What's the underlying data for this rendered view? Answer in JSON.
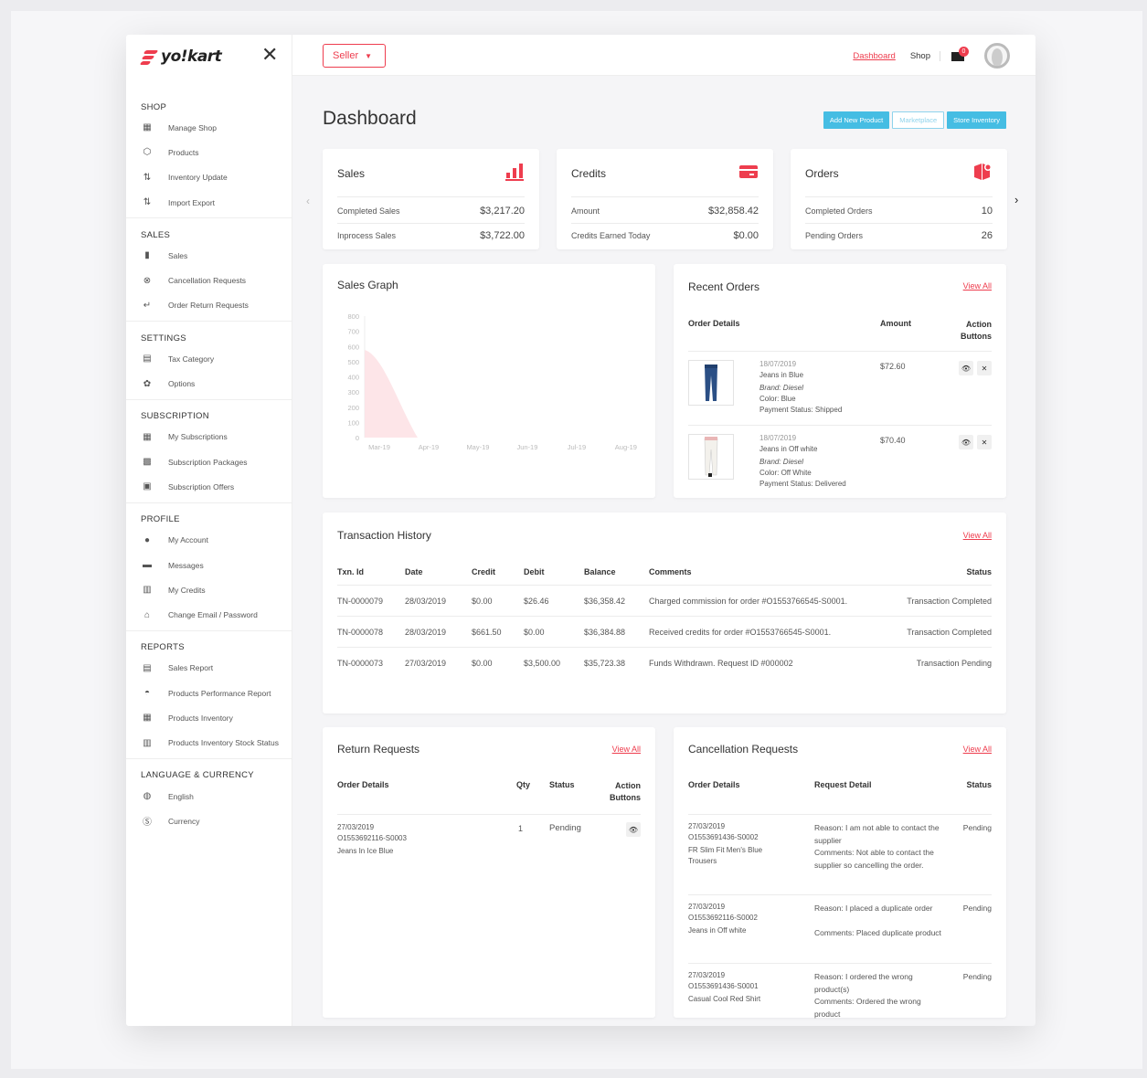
{
  "brand": {
    "logo_text": "yo!kart",
    "accent": "#ee3d4e",
    "info": "#45bde3"
  },
  "sidebar": {
    "sections": [
      {
        "title": "SHOP",
        "items": [
          {
            "label": "Manage Shop",
            "icon": "store-icon"
          },
          {
            "label": "Products",
            "icon": "box-icon"
          },
          {
            "label": "Inventory Update",
            "icon": "inventory-icon"
          },
          {
            "label": "Import Export",
            "icon": "import-export-icon"
          }
        ]
      },
      {
        "title": "SALES",
        "items": [
          {
            "label": "Sales",
            "icon": "bar-chart-icon"
          },
          {
            "label": "Cancellation Requests",
            "icon": "cancel-icon"
          },
          {
            "label": "Order Return Requests",
            "icon": "return-icon"
          }
        ]
      },
      {
        "title": "SETTINGS",
        "items": [
          {
            "label": "Tax Category",
            "icon": "tax-icon"
          },
          {
            "label": "Options",
            "icon": "gear-icon"
          }
        ]
      },
      {
        "title": "SUBSCRIPTION",
        "items": [
          {
            "label": "My Subscriptions",
            "icon": "subscription-icon"
          },
          {
            "label": "Subscription Packages",
            "icon": "package-icon"
          },
          {
            "label": "Subscription Offers",
            "icon": "offer-icon"
          }
        ]
      },
      {
        "title": "PROFILE",
        "items": [
          {
            "label": "My Account",
            "icon": "user-icon"
          },
          {
            "label": "Messages",
            "icon": "message-icon"
          },
          {
            "label": "My Credits",
            "icon": "credits-icon"
          },
          {
            "label": "Change Email / Password",
            "icon": "lock-icon"
          }
        ]
      },
      {
        "title": "REPORTS",
        "items": [
          {
            "label": "Sales Report",
            "icon": "report-icon"
          },
          {
            "label": "Products Performance Report",
            "icon": "performance-icon"
          },
          {
            "label": "Products Inventory",
            "icon": "products-inventory-icon"
          },
          {
            "label": "Products Inventory Stock Status",
            "icon": "stock-status-icon"
          }
        ]
      },
      {
        "title": "LANGUAGE & CURRENCY",
        "items": [
          {
            "label": "English",
            "icon": "globe-icon"
          },
          {
            "label": "Currency",
            "icon": "currency-icon"
          }
        ]
      }
    ]
  },
  "topbar": {
    "seller_label": "Seller",
    "dashboard_link": "Dashboard",
    "shop_link": "Shop",
    "notification_count": "0"
  },
  "page": {
    "title": "Dashboard",
    "buttons": [
      "Add New Product",
      "Marketplace",
      "Store Inventory"
    ]
  },
  "stats": [
    {
      "title": "Sales",
      "icon": "sales-chart-icon",
      "rows": [
        {
          "label": "Completed Sales",
          "value": "$3,217.20"
        },
        {
          "label": "Inprocess Sales",
          "value": "$3,722.00"
        }
      ]
    },
    {
      "title": "Credits",
      "icon": "credit-card-icon",
      "rows": [
        {
          "label": "Amount",
          "value": "$32,858.42"
        },
        {
          "label": "Credits Earned Today",
          "value": "$0.00"
        }
      ]
    },
    {
      "title": "Orders",
      "icon": "orders-box-icon",
      "rows": [
        {
          "label": "Completed Orders",
          "value": "10"
        },
        {
          "label": "Pending Orders",
          "value": "26"
        }
      ]
    }
  ],
  "sales_graph": {
    "title": "Sales Graph",
    "chart_data": {
      "type": "area",
      "categories": [
        "Mar-19",
        "Apr-19",
        "May-19",
        "Jun-19",
        "Jul-19",
        "Aug-19"
      ],
      "values": [
        650,
        0,
        0,
        0,
        0,
        0
      ],
      "yticks": [
        "800",
        "700",
        "600",
        "500",
        "400",
        "300",
        "200",
        "100",
        "0"
      ],
      "ylim": [
        0,
        800
      ]
    }
  },
  "recent_orders": {
    "title": "Recent Orders",
    "view_all": "View All",
    "headers": {
      "details": "Order Details",
      "amount": "Amount",
      "action": "Action Buttons"
    },
    "rows": [
      {
        "date": "18/07/2019",
        "name": "Jeans in Blue",
        "brand": "Brand: Diesel",
        "color": "Color: Blue",
        "payment": "Payment Status: Shipped",
        "amount": "$72.60"
      },
      {
        "date": "18/07/2019",
        "name": "Jeans in Off white",
        "brand": "Brand: Diesel",
        "color": "Color: Off White",
        "payment": "Payment Status: Delivered",
        "amount": "$70.40"
      }
    ]
  },
  "transactions": {
    "title": "Transaction History",
    "view_all": "View All",
    "headers": [
      "Txn. Id",
      "Date",
      "Credit",
      "Debit",
      "Balance",
      "Comments",
      "Status"
    ],
    "rows": [
      [
        "TN-0000079",
        "28/03/2019",
        "$0.00",
        "$26.46",
        "$36,358.42",
        "Charged commission for order #O1553766545-S0001.",
        "Transaction Completed"
      ],
      [
        "TN-0000078",
        "28/03/2019",
        "$661.50",
        "$0.00",
        "$36,384.88",
        "Received credits for order #O1553766545-S0001.",
        "Transaction Completed"
      ],
      [
        "TN-0000073",
        "27/03/2019",
        "$0.00",
        "$3,500.00",
        "$35,723.38",
        "Funds Withdrawn. Request ID #000002",
        "Transaction Pending"
      ]
    ]
  },
  "returns": {
    "title": "Return Requests",
    "view_all": "View All",
    "headers": {
      "details": "Order Details",
      "qty": "Qty",
      "status": "Status",
      "action": "Action Buttons"
    },
    "rows": [
      {
        "date": "27/03/2019",
        "order": "O1553692116-S0003",
        "name": "Jeans In Ice Blue",
        "qty": "1",
        "status": "Pending"
      }
    ]
  },
  "cancellations": {
    "title": "Cancellation Requests",
    "view_all": "View All",
    "headers": {
      "details": "Order Details",
      "request": "Request Detail",
      "status": "Status"
    },
    "rows": [
      {
        "date": "27/03/2019",
        "order": "O1553691436-S0002",
        "name": "FR Slim Fit Men's Blue Trousers",
        "reason": "Reason: I am not able to contact the supplier",
        "comments": "Comments: Not able to contact the supplier so cancelling the order.",
        "status": "Pending"
      },
      {
        "date": "27/03/2019",
        "order": "O1553692116-S0002",
        "name": "Jeans in Off white",
        "reason": "Reason: I placed a duplicate order",
        "comments": "Comments: Placed duplicate product",
        "status": "Pending"
      },
      {
        "date": "27/03/2019",
        "order": "O1553691436-S0001",
        "name": "Casual Cool Red Shirt",
        "reason": "Reason: I ordered the wrong product(s)",
        "comments": "Comments: Ordered the wrong product",
        "status": "Pending"
      }
    ]
  }
}
